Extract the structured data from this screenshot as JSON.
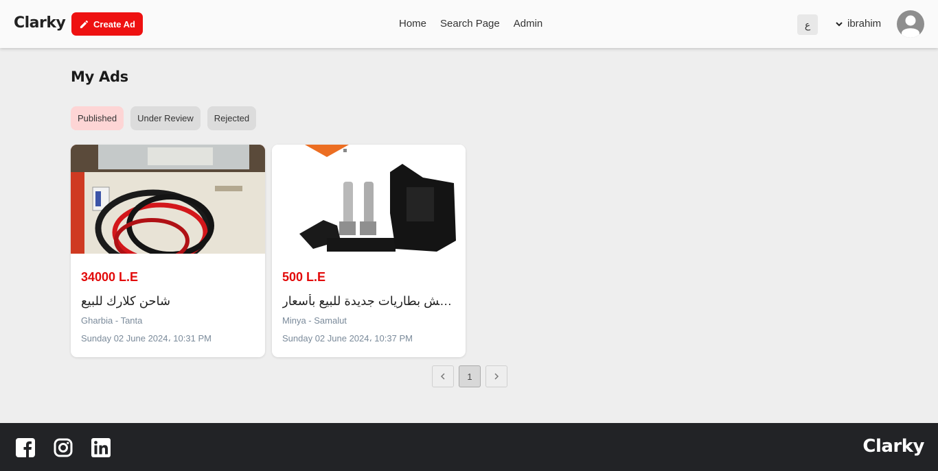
{
  "header": {
    "logo": "Clarky",
    "create_ad_label": "Create Ad",
    "nav": [
      "Home",
      "Search Page",
      "Admin"
    ],
    "language_toggle": "ع",
    "username": "ibrahim"
  },
  "page_title": "My Ads",
  "tabs": [
    {
      "label": "Published",
      "active": true
    },
    {
      "label": "Under Review",
      "active": false
    },
    {
      "label": "Rejected",
      "active": false
    }
  ],
  "ads": [
    {
      "price": "34000 L.E",
      "title": "شاحن كلارك للبيع",
      "location": "Gharbia - Tanta",
      "date": "Sunday 02 June 2024، 10:31 PM"
    },
    {
      "price": "500 L.E",
      "title": "فيش بطاريات جديدة للبيع بأسعار...",
      "location": "Minya - Samalut",
      "date": "Sunday 02 June 2024، 10:37 PM"
    }
  ],
  "pagination": {
    "current_page": "1"
  },
  "footer": {
    "logo": "Clarky"
  },
  "colors": {
    "accent": "#ee1111",
    "price": "#e20a0a",
    "footer_bg": "#222326"
  }
}
